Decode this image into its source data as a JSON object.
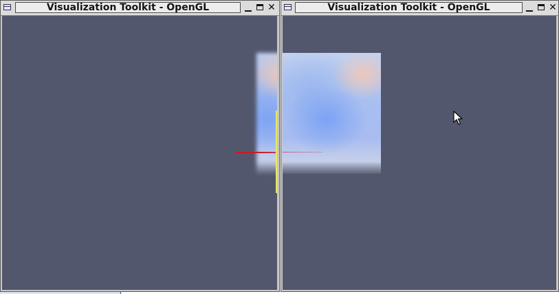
{
  "windows": [
    {
      "title": "Visualization Toolkit - OpenGL",
      "viewport_background": "#52576e",
      "controls": {
        "minimize_icon": "minimize-icon",
        "maximize_icon": "maximize-icon",
        "close_icon": "close-icon"
      }
    },
    {
      "title": "Visualization Toolkit - OpenGL",
      "viewport_background": "#52576e",
      "controls": {
        "minimize_icon": "minimize-icon",
        "maximize_icon": "maximize-icon",
        "close_icon": "close-icon"
      }
    }
  ],
  "glyphs": {
    "close": "✕"
  },
  "colors": {
    "volume_light": "#c4d2ef",
    "volume_blue": "#a9bff0",
    "volume_peach": "#f0c8b9",
    "x_axis": "#d01818",
    "y_axis": "#e8e85a",
    "titlebar": "#dcdcdc"
  }
}
